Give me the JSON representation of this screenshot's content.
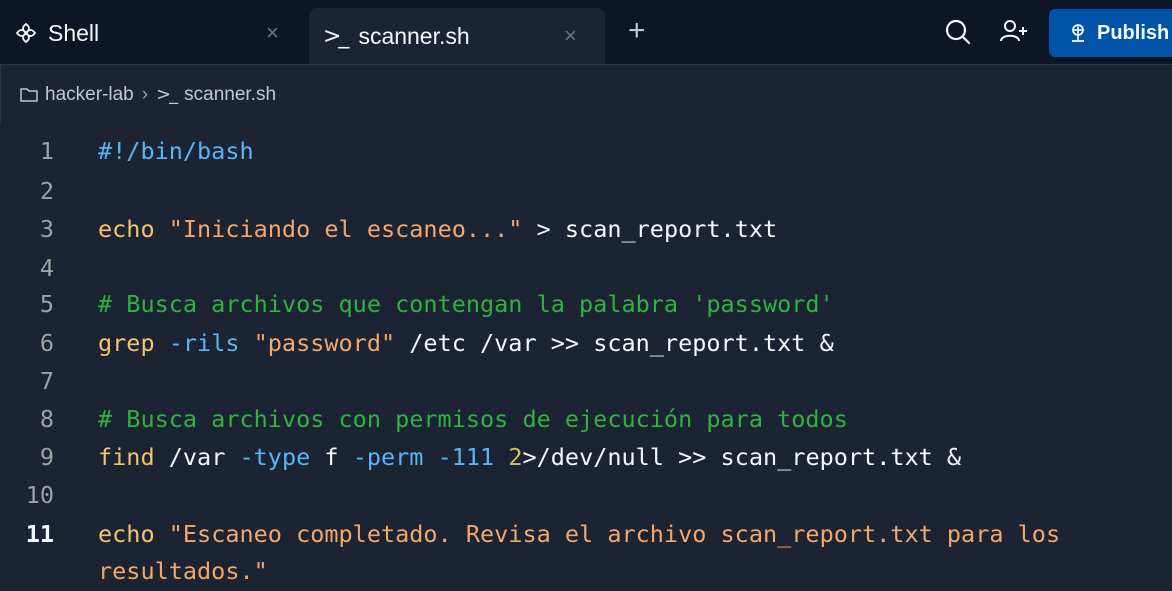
{
  "tabs": [
    {
      "icon": "shell-logo-icon",
      "label": "Shell",
      "close": "×"
    },
    {
      "icon": "terminal-prompt-icon",
      "prompt_glyph": ">_",
      "label": "scanner.sh",
      "close": "×"
    }
  ],
  "toolbar": {
    "new_tab": "+",
    "search_icon": "search-icon",
    "invite_icon": "add-user-icon",
    "publish_label": "Publish"
  },
  "breadcrumb": {
    "folder": "hacker-lab",
    "separator": "›",
    "prompt_glyph": ">_",
    "file": "scanner.sh"
  },
  "editor": {
    "lines": [
      {
        "n": "1",
        "tokens": [
          {
            "t": "#!/bin/bash",
            "c": "shebang"
          }
        ]
      },
      {
        "n": "2",
        "tokens": []
      },
      {
        "n": "3",
        "tokens": [
          {
            "t": "echo ",
            "c": "cmd"
          },
          {
            "t": "\"Iniciando el escaneo...\"",
            "c": "str"
          },
          {
            "t": " > scan_report.txt",
            "c": "plain"
          }
        ]
      },
      {
        "n": "4",
        "tokens": []
      },
      {
        "n": "5",
        "tokens": [
          {
            "t": "# Busca archivos que contengan la palabra 'password'",
            "c": "com"
          }
        ]
      },
      {
        "n": "6",
        "tokens": [
          {
            "t": "grep ",
            "c": "cmd"
          },
          {
            "t": "-rils ",
            "c": "opt"
          },
          {
            "t": "\"password\"",
            "c": "str"
          },
          {
            "t": " /etc /var >> scan_report.txt &",
            "c": "plain"
          }
        ]
      },
      {
        "n": "7",
        "tokens": []
      },
      {
        "n": "8",
        "tokens": [
          {
            "t": "# Busca archivos con permisos de ejecución para todos",
            "c": "com"
          }
        ]
      },
      {
        "n": "9",
        "tokens": [
          {
            "t": "find ",
            "c": "cmd"
          },
          {
            "t": "/var ",
            "c": "plain"
          },
          {
            "t": "-type ",
            "c": "opt"
          },
          {
            "t": "f ",
            "c": "plain"
          },
          {
            "t": "-perm ",
            "c": "opt"
          },
          {
            "t": "-111 ",
            "c": "opt"
          },
          {
            "t": "2",
            "c": "num"
          },
          {
            "t": ">/dev/null >> scan_report.txt &",
            "c": "plain"
          }
        ]
      },
      {
        "n": "10",
        "tokens": []
      },
      {
        "n": "11",
        "active": true,
        "tokens": [
          {
            "t": "echo ",
            "c": "cmd"
          },
          {
            "t": "\"Escaneo completado. Revisa el archivo scan_report.txt para los",
            "c": "str"
          }
        ]
      },
      {
        "n": "",
        "tokens": [
          {
            "t": "resultados.\"",
            "c": "str"
          }
        ]
      }
    ]
  },
  "colors": {
    "editor_bg": "#1c2333",
    "tabbar_bg": "#0e1525",
    "publish_bg": "#0053a6"
  }
}
